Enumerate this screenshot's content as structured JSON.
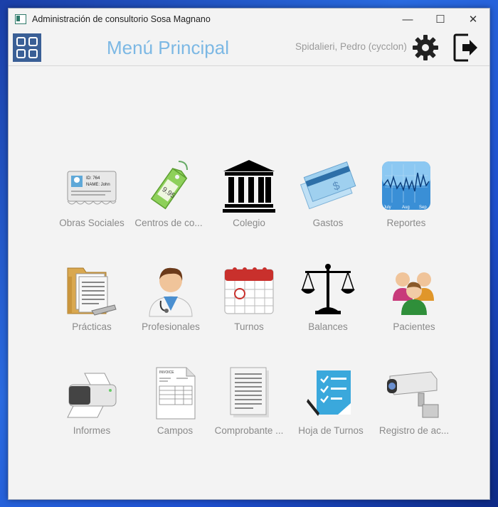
{
  "window": {
    "title": "Administración de consultorio Sosa Magnano",
    "minimize": "—",
    "maximize": "☐",
    "close": "✕"
  },
  "header": {
    "title": "Menú Principal",
    "user": "Spidalieri, Pedro (cycclon)"
  },
  "menu": [
    {
      "label": "Obras Sociales",
      "icon": "id-card-icon"
    },
    {
      "label": "Centros de co...",
      "icon": "price-tag-icon"
    },
    {
      "label": "Colegio",
      "icon": "building-icon"
    },
    {
      "label": "Gastos",
      "icon": "check-money-icon"
    },
    {
      "label": "Reportes",
      "icon": "chart-icon"
    },
    {
      "label": "Prácticas",
      "icon": "folder-icon"
    },
    {
      "label": "Profesionales",
      "icon": "doctor-icon"
    },
    {
      "label": "Turnos",
      "icon": "calendar-icon"
    },
    {
      "label": "Balances",
      "icon": "scale-icon"
    },
    {
      "label": "Pacientes",
      "icon": "people-icon"
    },
    {
      "label": "Informes",
      "icon": "printer-icon"
    },
    {
      "label": "Campos",
      "icon": "invoice-icon"
    },
    {
      "label": "Comprobante ...",
      "icon": "document-icon"
    },
    {
      "label": "Hoja de Turnos",
      "icon": "checklist-icon"
    },
    {
      "label": "Registro de ac...",
      "icon": "security-camera-icon"
    }
  ],
  "chart_icon_months": [
    "July",
    "Aug",
    "Sep"
  ],
  "invoice_icon_text": "INVOICE",
  "id_card_text": [
    "ID: 764",
    "NAME: John"
  ]
}
